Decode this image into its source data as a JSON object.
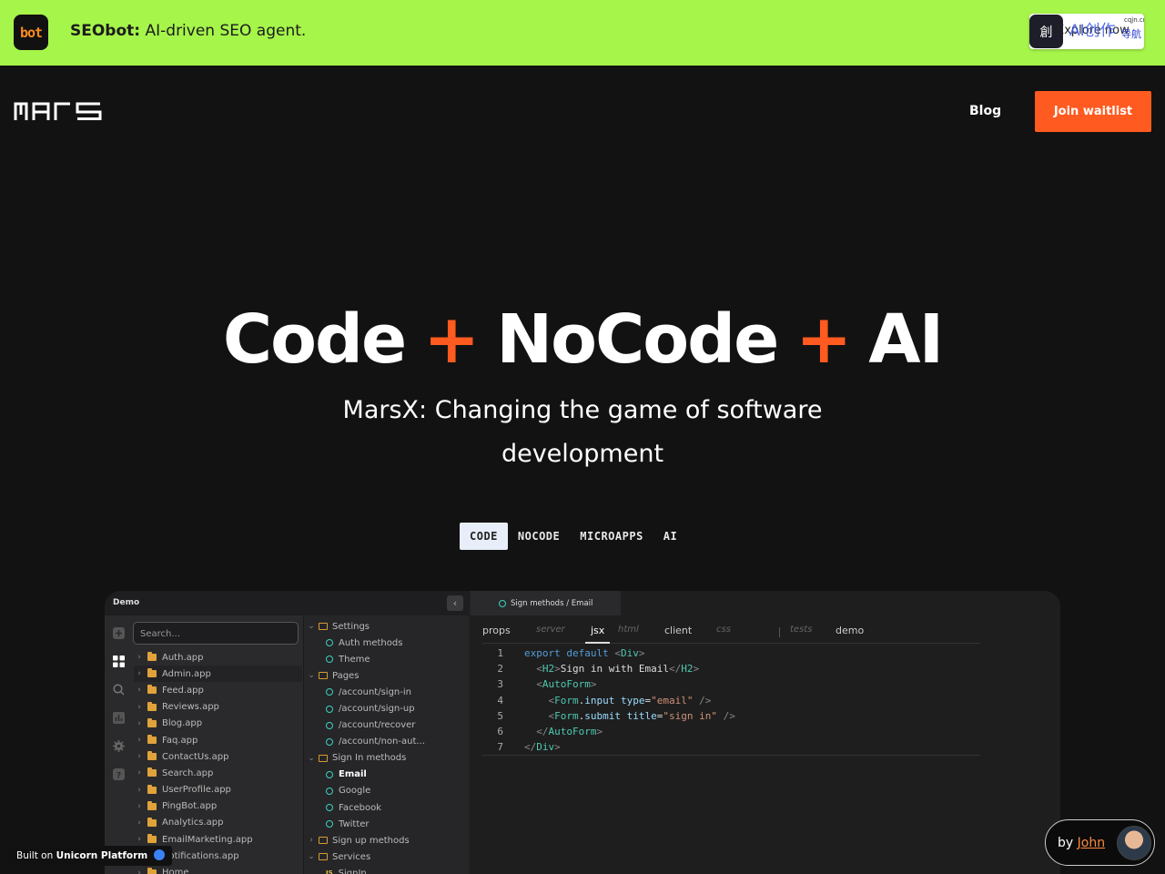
{
  "banner": {
    "logo_text": "bot",
    "brand": "SEObot:",
    "tagline": "AI-driven SEO agent.",
    "explore_label": "Explore now",
    "explore_cn": "AI创作",
    "explore_cn_sub": "导航",
    "explore_domain": "cqjn.cn"
  },
  "nav": {
    "logo": "MARS",
    "blog": "Blog",
    "join": "Join waitlist"
  },
  "hero": {
    "title_parts": [
      "Code",
      "+",
      "NoCode",
      "+",
      "AI"
    ],
    "subtitle": "MarsX: Changing the game of software development"
  },
  "tabs": [
    "CODE",
    "NOCODE",
    "MICROAPPS",
    "AI"
  ],
  "demo": {
    "title": "Demo",
    "search_placeholder": "Search...",
    "apps": [
      "Auth.app",
      "Admin.app",
      "Feed.app",
      "Reviews.app",
      "Blog.app",
      "Faq.app",
      "ContactUs.app",
      "Search.app",
      "UserProfile.app",
      "PingBot.app",
      "Analytics.app",
      "EmailMarketing.app",
      "Notifications.app",
      "Home"
    ],
    "tree": [
      {
        "type": "folder",
        "label": "Settings",
        "open": true
      },
      {
        "type": "item",
        "label": "Auth methods"
      },
      {
        "type": "item",
        "label": "Theme"
      },
      {
        "type": "folder",
        "label": "Pages",
        "open": true
      },
      {
        "type": "item",
        "label": "/account/sign-in"
      },
      {
        "type": "item",
        "label": "/account/sign-up"
      },
      {
        "type": "item",
        "label": "/account/recover"
      },
      {
        "type": "item",
        "label": "/account/non-aut..."
      },
      {
        "type": "folder",
        "label": "Sign In methods",
        "open": true
      },
      {
        "type": "item",
        "label": "Email",
        "selected": true
      },
      {
        "type": "item",
        "label": "Google"
      },
      {
        "type": "item",
        "label": "Facebook"
      },
      {
        "type": "item",
        "label": "Twitter"
      },
      {
        "type": "folder",
        "label": "Sign up methods",
        "open": false
      },
      {
        "type": "folder",
        "label": "Services",
        "open": true
      },
      {
        "type": "js",
        "label": "SignIn"
      }
    ],
    "file_tab": "Sign methods / Email",
    "sub_tabs": [
      {
        "label": "props",
        "style": "normal"
      },
      {
        "label": "server",
        "style": "dim"
      },
      {
        "label": "jsx",
        "style": "active"
      },
      {
        "label": "html",
        "style": "dim"
      },
      {
        "label": "client",
        "style": "normal"
      },
      {
        "label": "css",
        "style": "dim"
      },
      {
        "label": "tests",
        "style": "dim"
      },
      {
        "label": "demo",
        "style": "normal"
      }
    ],
    "code": [
      {
        "n": "1",
        "indent": "",
        "tokens": [
          [
            "kw",
            "export default "
          ],
          [
            "br",
            "<"
          ],
          [
            "tag",
            "Div"
          ],
          [
            "br",
            ">"
          ]
        ]
      },
      {
        "n": "2",
        "indent": "  ",
        "tokens": [
          [
            "br",
            "<"
          ],
          [
            "tag",
            "H2"
          ],
          [
            "br",
            ">"
          ],
          [
            "txt",
            "Sign in with Email"
          ],
          [
            "br",
            "</"
          ],
          [
            "tag",
            "H2"
          ],
          [
            "br",
            ">"
          ]
        ]
      },
      {
        "n": "3",
        "indent": "  ",
        "tokens": [
          [
            "br",
            "<"
          ],
          [
            "tag",
            "AutoForm"
          ],
          [
            "br",
            ">"
          ]
        ]
      },
      {
        "n": "4",
        "indent": "    ",
        "tokens": [
          [
            "br",
            "<"
          ],
          [
            "tag",
            "Form"
          ],
          [
            "txt",
            "."
          ],
          [
            "attr",
            "input "
          ],
          [
            "attr",
            "type"
          ],
          [
            "txt",
            "="
          ],
          [
            "str",
            "\"email\""
          ],
          [
            "br",
            " />"
          ]
        ]
      },
      {
        "n": "5",
        "indent": "    ",
        "tokens": [
          [
            "br",
            "<"
          ],
          [
            "tag",
            "Form"
          ],
          [
            "txt",
            "."
          ],
          [
            "attr",
            "submit "
          ],
          [
            "attr",
            "title"
          ],
          [
            "txt",
            "="
          ],
          [
            "str",
            "\"sign in\""
          ],
          [
            "br",
            " />"
          ]
        ]
      },
      {
        "n": "6",
        "indent": "  ",
        "tokens": [
          [
            "br",
            "</"
          ],
          [
            "tag",
            "AutoForm"
          ],
          [
            "br",
            ">"
          ]
        ]
      },
      {
        "n": "7",
        "indent": "",
        "tokens": [
          [
            "br",
            "</"
          ],
          [
            "tag",
            "Div"
          ],
          [
            "br",
            ">"
          ]
        ]
      }
    ]
  },
  "footer": {
    "built_on_prefix": "Built on",
    "built_on_brand": "Unicorn Platform",
    "by_prefix": "by",
    "by_name": "John"
  }
}
